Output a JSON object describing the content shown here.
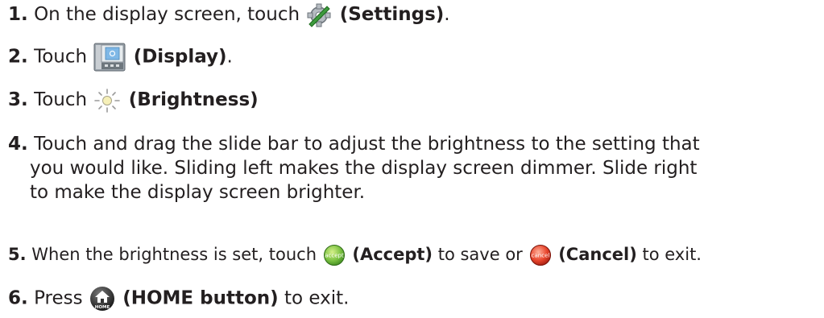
{
  "steps": [
    {
      "num": "1.",
      "before": "On the display screen, touch",
      "bold": "(Settings)",
      "after": ".",
      "icon": "settings-icon"
    },
    {
      "num": "2.",
      "before": "Touch",
      "bold": "(Display)",
      "after": ".",
      "icon": "display-icon"
    },
    {
      "num": "3.",
      "before": "Touch",
      "bold": "(Brightness)",
      "after": "",
      "icon": "brightness-icon"
    },
    {
      "num": "4.",
      "lines": [
        "Touch and drag the slide bar to adjust the brightness to the setting that",
        "you would like. Sliding left makes the display screen dimmer. Slide right",
        "to make the display screen brighter."
      ]
    },
    {
      "num": "5.",
      "before": "When the brightness is set, touch",
      "bold": "(Accept)",
      "middle": "to save or",
      "bold2": "(Cancel)",
      "after": "to exit.",
      "icon": "accept-icon",
      "icon2": "cancel-icon",
      "icon_text": "accept",
      "icon2_text": "cancel"
    },
    {
      "num": "6.",
      "before": "Press",
      "bold": "(HOME button)",
      "after": "to exit.",
      "icon": "home-icon",
      "icon_text": "HOME"
    }
  ],
  "colors": {
    "text": "#231f20",
    "accept": "#7cc242",
    "cancel": "#e8452c",
    "home": "#3a3a3a"
  }
}
